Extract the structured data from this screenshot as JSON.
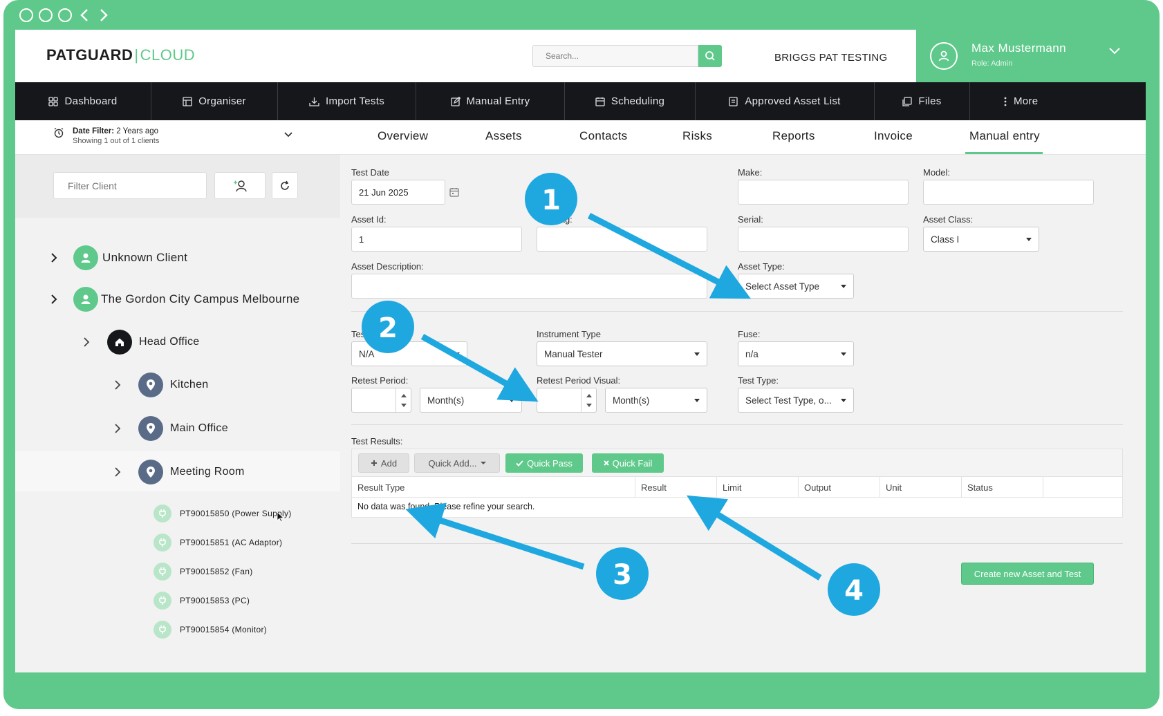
{
  "header": {
    "logo_bold": "PATGUARD",
    "logo_sep": "|",
    "logo_light": "CLOUD",
    "search_placeholder": "Search...",
    "company": "BRIGGS PAT TESTING",
    "user_name": "Max Mustermann",
    "user_role": "Role: Admin"
  },
  "nav": {
    "items": [
      {
        "label": "Dashboard",
        "icon": "dashboard-icon"
      },
      {
        "label": "Organiser",
        "icon": "organiser-icon"
      },
      {
        "label": "Import Tests",
        "icon": "import-icon"
      },
      {
        "label": "Manual Entry",
        "icon": "edit-icon"
      },
      {
        "label": "Scheduling",
        "icon": "calendar-icon"
      },
      {
        "label": "Approved Asset List",
        "icon": "list-icon"
      },
      {
        "label": "Files",
        "icon": "files-icon"
      },
      {
        "label": "More",
        "icon": "more-icon"
      }
    ]
  },
  "sidebar": {
    "date_filter_label": "Date Filter:",
    "date_filter_value": "2 Years ago",
    "showing": "Showing 1 out of 1 clients",
    "filter_placeholder": "Filter Client",
    "tree": [
      {
        "label": "Unknown Client"
      },
      {
        "label": "The Gordon City Campus Melbourne"
      },
      {
        "label": "Head Office"
      },
      {
        "label": "Kitchen"
      },
      {
        "label": "Main Office"
      },
      {
        "label": "Meeting Room"
      },
      {
        "label": "PT90015850 (Power Supply)"
      },
      {
        "label": "PT90015851 (AC Adaptor)"
      },
      {
        "label": "PT90015852 (Fan)"
      },
      {
        "label": "PT90015853 (PC)"
      },
      {
        "label": "PT90015854 (Monitor)"
      }
    ]
  },
  "tabs": [
    "Overview",
    "Assets",
    "Contacts",
    "Risks",
    "Reports",
    "Invoice",
    "Manual entry"
  ],
  "form": {
    "test_date_label": "Test Date",
    "test_date_value": "21 Jun 2025",
    "make_label": "Make:",
    "model_label": "Model:",
    "asset_id_label": "Asset Id:",
    "asset_id_value": "1",
    "test_tag_label": "Test Tag:",
    "serial_label": "Serial:",
    "asset_class_label": "Asset Class:",
    "asset_class_value": "Class I",
    "asset_desc_label": "Asset Description:",
    "asset_type_label": "Asset Type:",
    "asset_type_value": "Select Asset Type",
    "tested_by_label": "Tested By:",
    "tested_by_value": "N/A",
    "instrument_label": "Instrument Type",
    "instrument_value": "Manual Tester",
    "fuse_label": "Fuse:",
    "fuse_value": "n/a",
    "retest_label": "Retest Period:",
    "retest_unit": "Month(s)",
    "retest_visual_label": "Retest Period Visual:",
    "retest_visual_unit": "Month(s)",
    "test_type_label": "Test Type:",
    "test_type_value": "Select Test Type, o..."
  },
  "results": {
    "label": "Test Results:",
    "add": "Add",
    "quick_add": "Quick Add...",
    "quick_pass": "Quick Pass",
    "quick_fail": "Quick Fail",
    "columns": [
      "Result Type",
      "Result",
      "Limit",
      "Output",
      "Unit",
      "Status"
    ],
    "empty": "No data was found. Please refine your search."
  },
  "create_button": "Create new Asset and Test",
  "annotations": [
    "1",
    "2",
    "3",
    "4"
  ],
  "colors": {
    "brand": "#5ec98a",
    "nav": "#15171b",
    "annotation": "#1fa8e0"
  }
}
